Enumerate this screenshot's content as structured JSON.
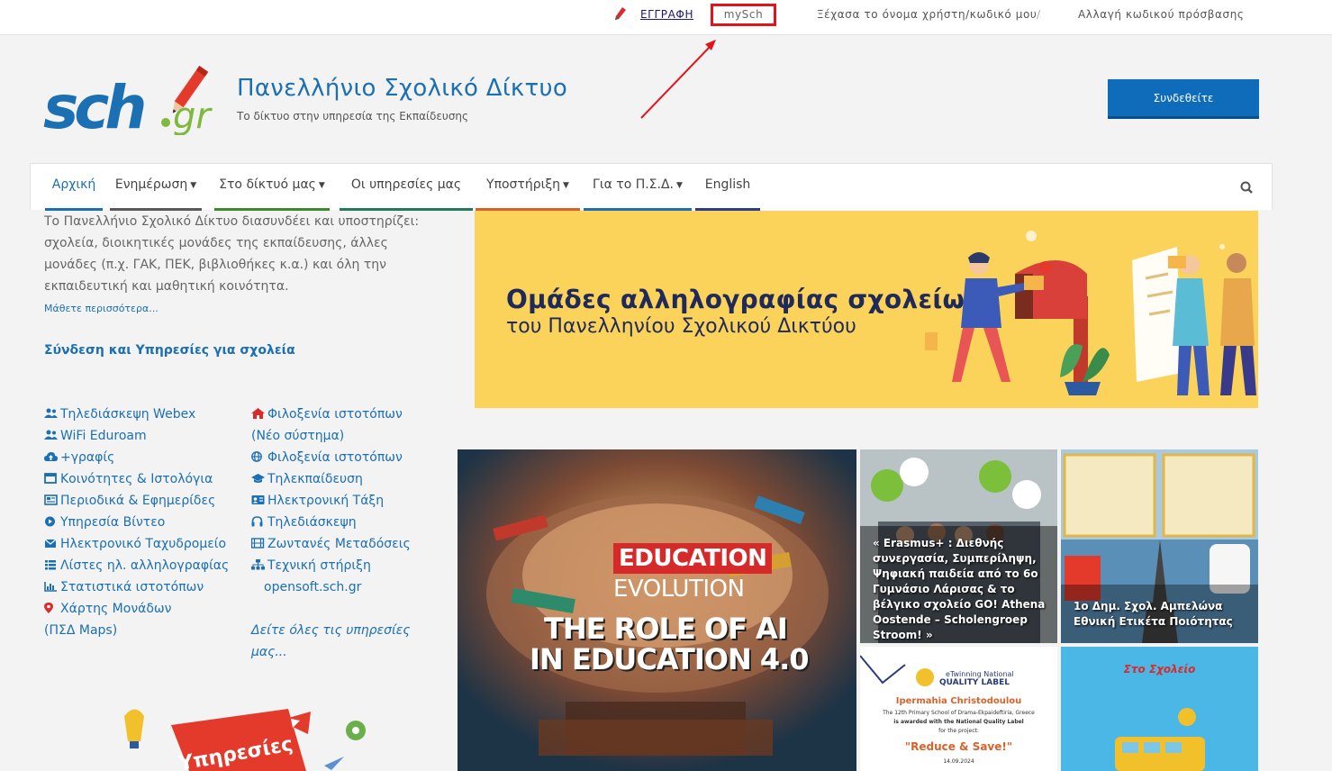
{
  "topbar": {
    "register": "ΕΓΓΡΑΦΗ",
    "mysch": "mySch",
    "forgot": "Ξέχασα το όνομα χρήστη/κωδικό μου",
    "separator": "/",
    "change_password": "Αλλαγή κωδικού πρόσβασης"
  },
  "header": {
    "logo_text": "sch.gr",
    "title": "Πανελλήνιο Σχολικό Δίκτυο",
    "subtitle": "Το δίκτυο στην υπηρεσία της Εκπαίδευσης",
    "connect_button": "Συνδεθείτε"
  },
  "nav": {
    "items": [
      {
        "label": "Αρχική",
        "caret": false,
        "color": "#1b6fb3"
      },
      {
        "label": "Ενημέρωση",
        "caret": true,
        "color": "#5a5a5a"
      },
      {
        "label": "Στο δίκτυό μας",
        "caret": true,
        "color": "#3c8a2d"
      },
      {
        "label": "Οι υπηρεσίες μας",
        "caret": false,
        "color": "#247a5a"
      },
      {
        "label": "Υποστήριξη",
        "caret": true,
        "color": "#d9622b"
      },
      {
        "label": "Για το Π.Σ.Δ.",
        "caret": true,
        "color": "#1f6fb5"
      },
      {
        "label": "English",
        "caret": false,
        "color": "#2a3c8e"
      }
    ]
  },
  "intro": {
    "text": "Το Πανελλήνιο Σχολικό Δίκτυο διασυνδέει και υποστηρίζει: σχολεία, διοικητικές μονάδες της εκπαίδευσης,  άλλες μονάδες (π.χ. ΓΑΚ, ΠΕΚ, βιβλιοθήκες κ.α.) και όλη την εκπαιδευτική και μαθητική κοινότητα.",
    "more": "Μάθετε περισσότερα..."
  },
  "services": {
    "title": "Σύνδεση και Υπηρεσίες για σχολεία",
    "left": [
      "Τηλεδιάσκεψη Webex",
      "WiFi Eduroam",
      "+γραφίς",
      "Κοινότητες & Ιστολόγια",
      "Περιοδικά & Εφημερίδες",
      "Υπηρεσία Βίντεο",
      "Ηλεκτρονικό Ταχυδρομείο",
      "Λίστες ηλ. αλληλογραφίας",
      "Στατιστικά ιστοτόπων",
      "Χάρτης Μονάδων",
      "(ΠΣΔ Maps)"
    ],
    "right": [
      "Φιλοξενία ιστοτόπων",
      "(Νέο σύστημα)",
      "Φιλοξενία ιστοτόπων",
      "Τηλεκπαίδευση",
      "Ηλεκτρονική Τάξη",
      "Τηλεδιάσκεψη",
      "Ζωντανές Μεταδόσεις",
      "Τεχνική στήριξη",
      "opensoft.sch.gr"
    ],
    "all_line1": "Δείτε όλες τις υπηρεσίες",
    "all_line2": "μας..."
  },
  "banner": {
    "line1": "Ομάδες αλληλογραφίας σχολείων",
    "line2": "του Πανελληνίου Σχολικού Δικτύου"
  },
  "news": {
    "main_badge": "EDUCATION",
    "main_badge2": "EVOLUTION",
    "main_line1": "THE ROLE OF AI",
    "main_line2": "IN EDUCATION 4.0",
    "tile1_caption": "« Erasmus+ : Διεθνής συνεργασία, Συμπερίληψη, Ψηφιακή παιδεία από το 6ο Γυμνάσιο Λάρισας & το βέλγικο σχολείο GO! Athena Oostende – Scholengroep Stroom! »",
    "tile2_caption": "1ο Δημ. Σχολ. Αμπελώνα Εθνική Ετικέτα Ποιότητας",
    "tile3_line1": "eTwinning National",
    "tile3_line2": "QUALITY LABEL",
    "tile3_name": "Ipermahia Christodoulou",
    "tile3_school": "The 12th Primary School of Drama-Ekpaideftiria, Greece",
    "tile3_award": "is awarded with the National Quality Label",
    "tile3_for": "for the project:",
    "tile3_project": "\"Reduce & Save!\"",
    "tile3_date": "14.09.2024",
    "tile4_title": "Στο Σχολείο"
  },
  "promo": {
    "text": "Υπηρεσίες"
  }
}
